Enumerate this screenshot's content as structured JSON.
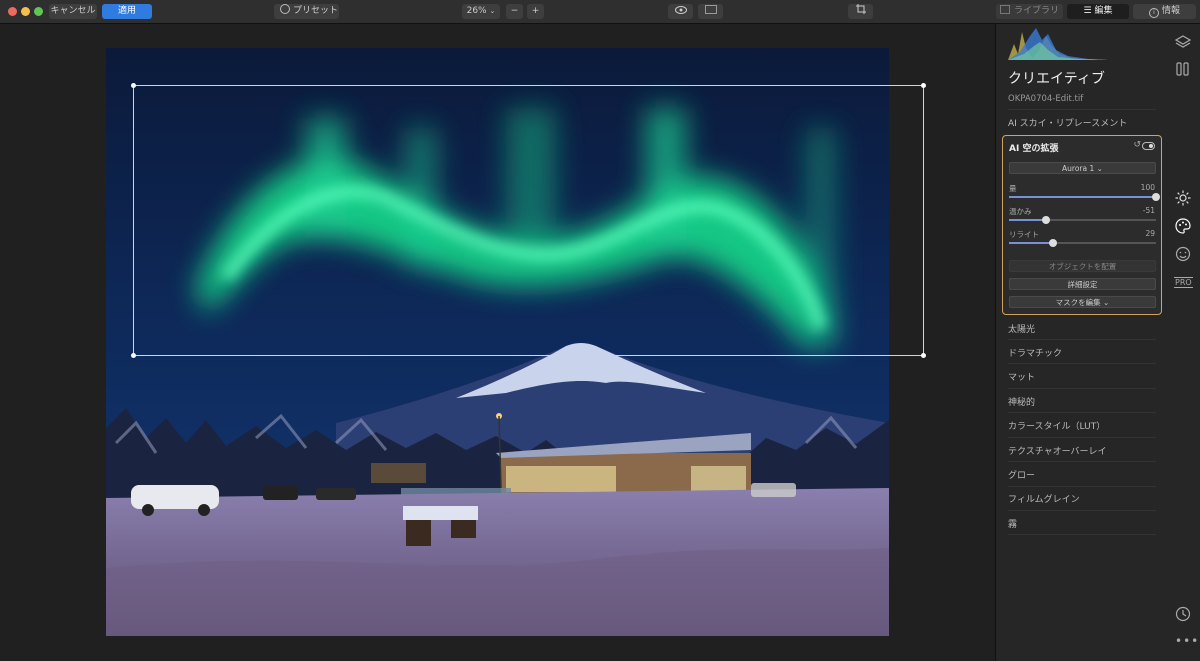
{
  "toolbar": {
    "cancel_label": "キャンセル",
    "apply_label": "適用",
    "presets_label": "プリセット",
    "zoom_label": "26%",
    "zoom_out": "−",
    "zoom_in": "+",
    "compare_label": "比較",
    "library_label": "ライブラリ",
    "edit_label": "編集",
    "info_label": "情報"
  },
  "panel": {
    "title": "クリエイティブ",
    "filename": "OKPA0704-Edit.tif",
    "sky_replacement": "AI スカイ・リプレースメント",
    "card": {
      "title": "AI 空の拡張",
      "preset": "Aurora 1",
      "sliders": [
        {
          "label": "量",
          "value": "100",
          "fraction": 1.0
        },
        {
          "label": "温かみ",
          "value": "-51",
          "fraction": 0.25
        },
        {
          "label": "リライト",
          "value": "29",
          "fraction": 0.3
        }
      ],
      "place_objects": "オブジェクトを配置",
      "advanced": "詳細設定",
      "edit_mask": "マスクを編集"
    },
    "tools": [
      "太陽光",
      "ドラマチック",
      "マット",
      "神秘的",
      "カラースタイル（LUT）",
      "テクスチャオーバーレイ",
      "グロー",
      "フィルムグレイン",
      "霧"
    ]
  },
  "sidebar": {
    "pro_label": "PRO"
  }
}
